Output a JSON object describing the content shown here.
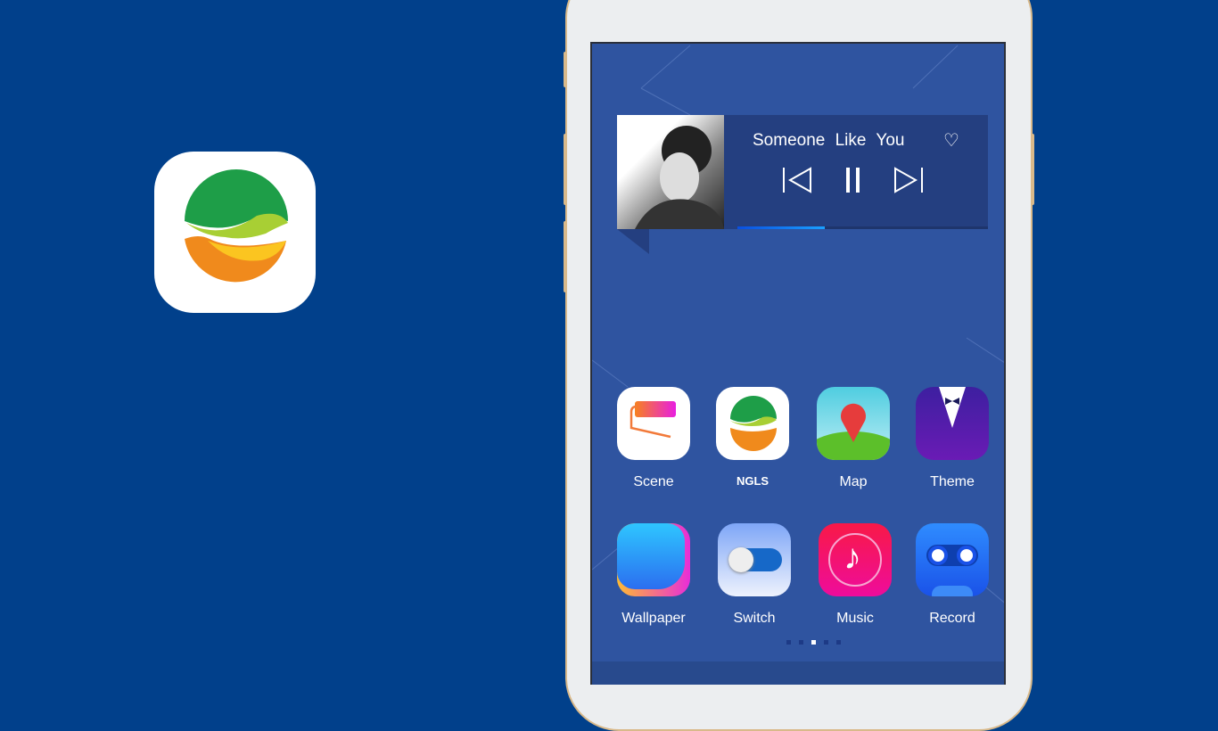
{
  "promo": {
    "logo_icon": "ngls-logo-icon"
  },
  "player": {
    "title": "Someone Like You",
    "progress_percent": 35,
    "heart_icon": "heart-icon",
    "prev_icon": "skip-previous-icon",
    "pause_icon": "pause-icon",
    "next_icon": "skip-next-icon",
    "album_art": "album-art-image"
  },
  "apps": [
    {
      "label": "Scene",
      "icon": "scene-icon"
    },
    {
      "label": "NGLS",
      "icon": "ngls-icon"
    },
    {
      "label": "Map",
      "icon": "map-pin-icon"
    },
    {
      "label": "Theme",
      "icon": "tuxedo-icon"
    },
    {
      "label": "Wallpaper",
      "icon": "wallpaper-icon"
    },
    {
      "label": "Switch",
      "icon": "toggle-icon"
    },
    {
      "label": "Music",
      "icon": "music-note-icon"
    },
    {
      "label": "Record",
      "icon": "cassette-icon"
    }
  ],
  "pager": {
    "pages": 5,
    "current": 3
  },
  "colors": {
    "background": "#01408b",
    "screen": "#2f54a0",
    "widget": "#243f80"
  }
}
